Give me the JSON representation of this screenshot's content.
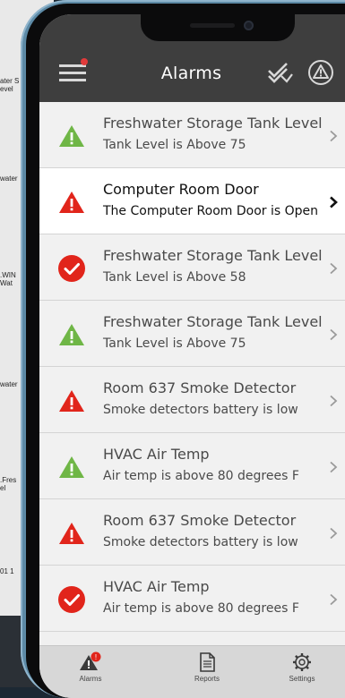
{
  "background_window": {
    "fragments": [
      "ater S\nevel",
      "water",
      ".WIN\nWat",
      "water",
      ".Fres\nel",
      "01 1"
    ]
  },
  "header": {
    "title": "Alarms",
    "menu_icon": "hamburger-menu-icon",
    "acknowledge_icon": "double-check-icon",
    "warning_icon": "warning-circle-icon"
  },
  "alarms": [
    {
      "title": "Freshwater Storage Tank Level",
      "subtitle": "Tank Level is Above 75",
      "icon": "green-warning-triangle-icon",
      "selected": false
    },
    {
      "title": "Computer Room Door",
      "subtitle": "The Computer Room Door is Open",
      "icon": "red-warning-triangle-icon",
      "selected": true
    },
    {
      "title": "Freshwater Storage Tank Level",
      "subtitle": "Tank Level is Above 58",
      "icon": "red-check-circle-icon",
      "selected": false
    },
    {
      "title": "Freshwater Storage Tank Level",
      "subtitle": "Tank Level is Above 75",
      "icon": "green-warning-triangle-icon",
      "selected": false
    },
    {
      "title": "Room 637 Smoke Detector",
      "subtitle": "Smoke detectors battery is low",
      "icon": "red-warning-triangle-icon",
      "selected": false
    },
    {
      "title": "HVAC Air Temp",
      "subtitle": "Air temp is above 80 degrees F",
      "icon": "green-warning-triangle-icon",
      "selected": false
    },
    {
      "title": "Room 637 Smoke Detector",
      "subtitle": "Smoke detectors battery is low",
      "icon": "red-warning-triangle-icon",
      "selected": false
    },
    {
      "title": "HVAC Air Temp",
      "subtitle": "Air temp is above 80 degrees F",
      "icon": "red-check-circle-icon",
      "selected": false
    }
  ],
  "tabs": [
    {
      "label": "Alarms",
      "icon": "alarm-warning-icon",
      "badge": "!"
    },
    {
      "label": "Reports",
      "icon": "document-icon"
    },
    {
      "label": "Settings",
      "icon": "gear-icon"
    }
  ],
  "colors": {
    "header_bg": "#3e3e3e",
    "alarm_red": "#e1251b",
    "alarm_green": "#6fb646",
    "list_bg": "#f1f1f1",
    "tab_bg": "#d7d7d7"
  }
}
